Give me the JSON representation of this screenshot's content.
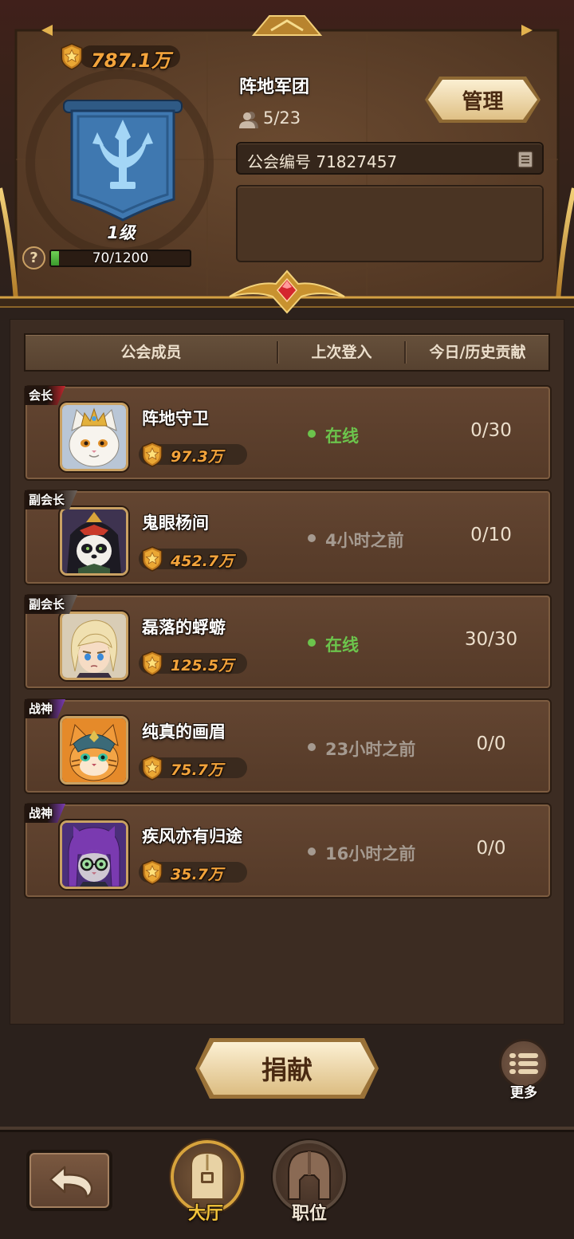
{
  "guild": {
    "power": "787.1万",
    "name": "阵地军团",
    "member_count": "5/23",
    "level": "1级",
    "exp": "70/1200",
    "exp_fraction": 0.058,
    "id_label": "公会编号",
    "id_number": "71827457",
    "manage_label": "管理",
    "help_label": "?"
  },
  "table_headers": {
    "member": "公会成员",
    "last_login": "上次登入",
    "contribution": "今日/历史贡献"
  },
  "status_colors": {
    "online": "#6cc44c",
    "offline": "#a59a90"
  },
  "members": [
    {
      "role": "会长",
      "role_color": "#c3262e",
      "avatar": "white-cat-king-avatar",
      "name": "阵地守卫",
      "power": "97.3万",
      "online": true,
      "status": "在线",
      "contribution": "0/30"
    },
    {
      "role": "副会长",
      "role_color": "#6b625c",
      "avatar": "panda-hood-avatar",
      "name": "鬼眼杨间",
      "power": "452.7万",
      "online": false,
      "status": "4小时之前",
      "contribution": "0/10"
    },
    {
      "role": "副会长",
      "role_color": "#6b625c",
      "avatar": "blonde-knight-avatar",
      "name": "磊落的蜉蝣",
      "power": "125.5万",
      "online": true,
      "status": "在线",
      "contribution": "30/30"
    },
    {
      "role": "战神",
      "role_color": "#7a3cb4",
      "avatar": "tiger-cat-helmet-avatar",
      "name": "纯真的画眉",
      "power": "75.7万",
      "online": false,
      "status": "23小时之前",
      "contribution": "0/0"
    },
    {
      "role": "战神",
      "role_color": "#7a3cb4",
      "avatar": "purple-cat-glasses-avatar",
      "name": "疾风亦有归途",
      "power": "35.7万",
      "online": false,
      "status": "16小时之前",
      "contribution": "0/0"
    }
  ],
  "actions": {
    "donate": "捐献",
    "more": "更多"
  },
  "nav": {
    "hall": "大厅",
    "position": "职位",
    "active": "hall"
  },
  "colors": {
    "accent_gold": "#d7a33c",
    "power_orange": "#f3a43c",
    "banner_blue": "#3f78b0",
    "exp_green": "#4fb23a"
  },
  "icons": {
    "power": "star-shield-icon",
    "emblem": "trident-banner-icon",
    "members": "members-icon",
    "copy": "copy-icon",
    "more": "list-icon",
    "back": "back-arrow-icon",
    "hall": "hall-gate-icon",
    "position": "helmet-icon"
  }
}
